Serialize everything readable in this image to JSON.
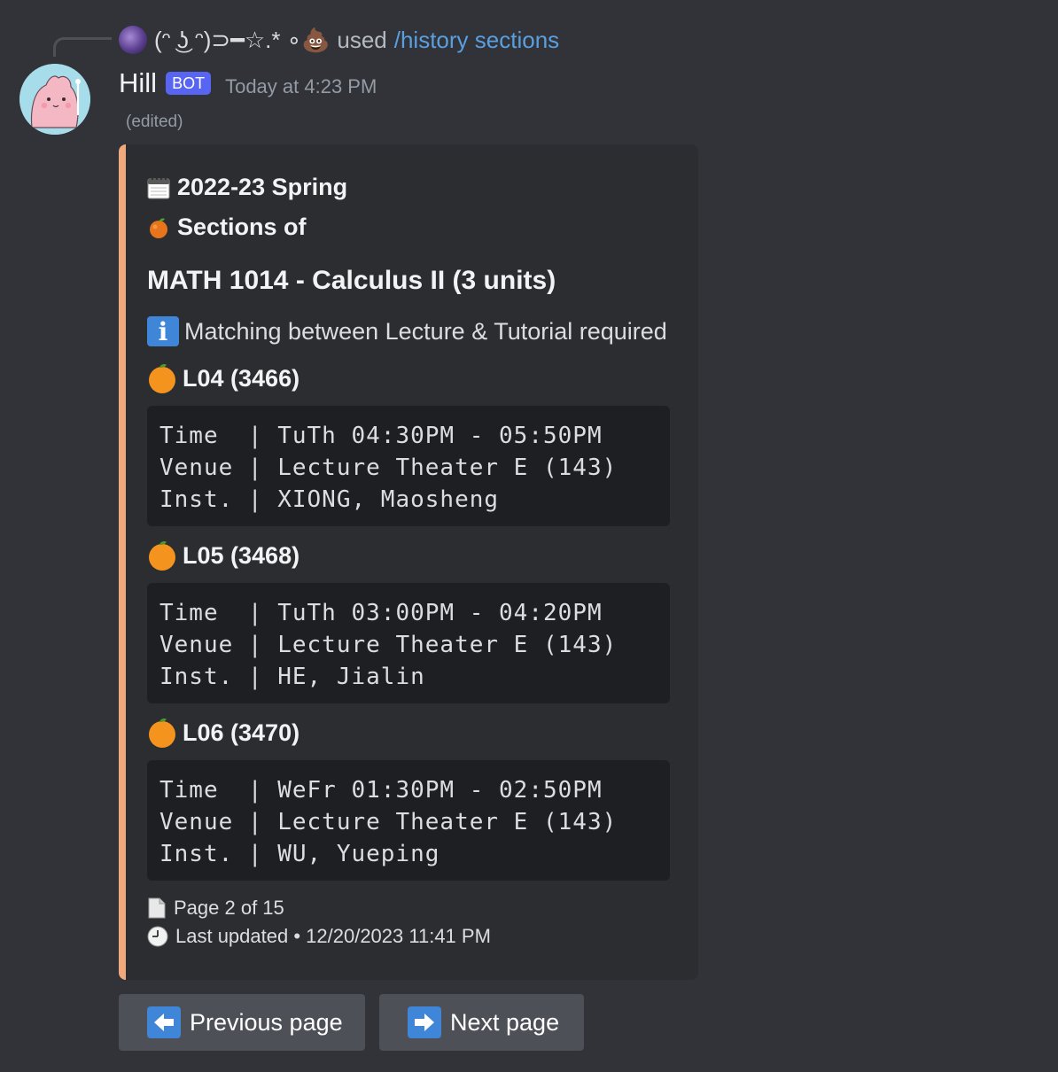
{
  "reply": {
    "user_name": "(ᵔ ͜ʖ ᵔ)⊃━☆.* ∘💩",
    "used_text": "used",
    "command": "/history sections"
  },
  "message": {
    "author": "Hill",
    "bot_tag": "BOT",
    "timestamp": "Today at 4:23 PM",
    "edited": "(edited)"
  },
  "embed": {
    "accent_color": "#f0a97d",
    "semester": "2022-23 Spring",
    "sections_of": "Sections of",
    "course_title": "MATH 1014 - Calculus II (3 units)",
    "info_text": "Matching between Lecture & Tutorial required",
    "sections": [
      {
        "heading": "L04 (3466)",
        "lines": [
          "Time  | TuTh 04:30PM - 05:50PM",
          "Venue | Lecture Theater E (143)",
          "Inst. | XIONG, Maosheng"
        ]
      },
      {
        "heading": "L05 (3468)",
        "lines": [
          "Time  | TuTh 03:00PM - 04:20PM",
          "Venue | Lecture Theater E (143)",
          "Inst. | HE, Jialin"
        ]
      },
      {
        "heading": "L06 (3470)",
        "lines": [
          "Time  | WeFr 01:30PM - 02:50PM",
          "Venue | Lecture Theater E (143)",
          "Inst. | WU, Yueping"
        ]
      }
    ],
    "page_text": "Page 2 of 15",
    "last_updated": "Last updated • 12/20/2023 11:41 PM"
  },
  "buttons": {
    "previous": "Previous page",
    "next": "Next page"
  },
  "icons": {
    "calendar": "calendar-icon",
    "fruit": "orange-fruit-icon",
    "info": "info-icon",
    "page": "page-icon",
    "clock": "clock-icon",
    "left_arrow": "left-arrow-icon",
    "right_arrow": "right-arrow-icon"
  }
}
